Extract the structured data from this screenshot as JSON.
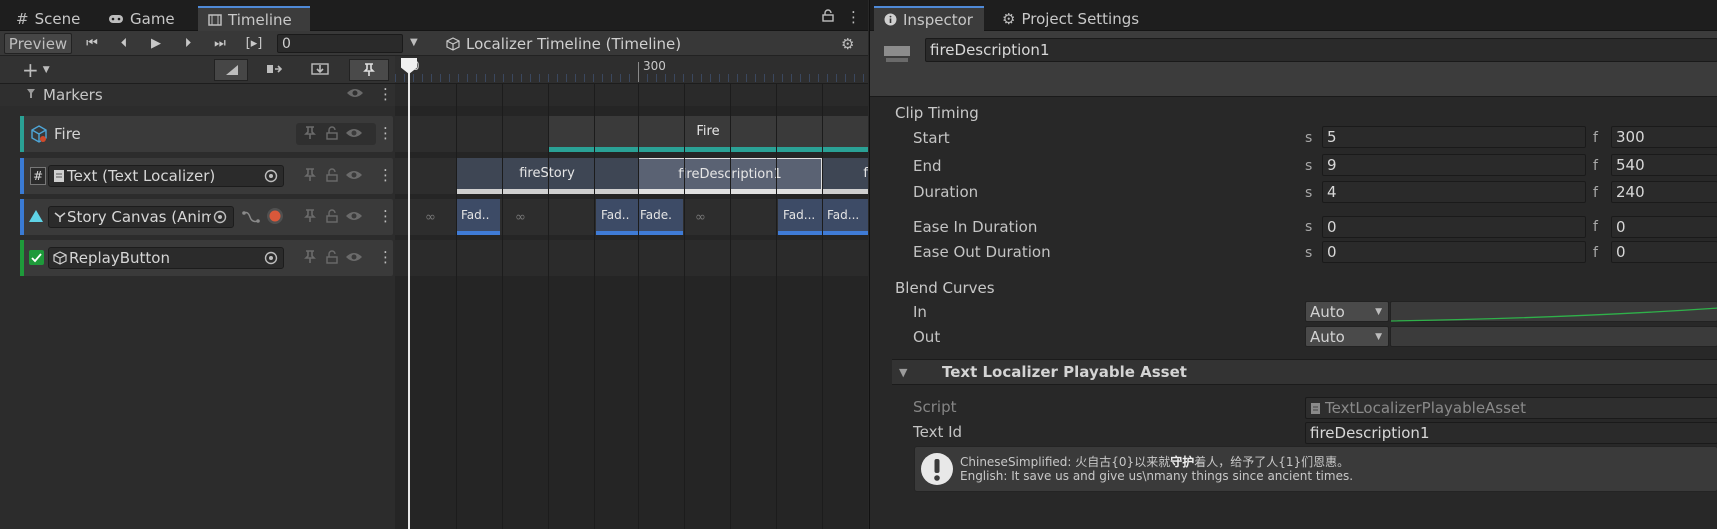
{
  "left_tabs": [
    {
      "label": "Scene",
      "icon": "grid-icon"
    },
    {
      "label": "Game",
      "icon": "gamepad-icon"
    },
    {
      "label": "Timeline",
      "icon": "film-icon"
    }
  ],
  "toolbar": {
    "preview_label": "Preview",
    "frame_value": "0",
    "asset_name": "Localizer Timeline (Timeline)"
  },
  "ruler": {
    "labels": [
      "0",
      "300"
    ]
  },
  "markers_label": "Markers",
  "tracks": [
    {
      "name": "Fire",
      "color": "#2aa195"
    },
    {
      "name": "Text (Text Localizer)",
      "color": "#3a7bd5"
    },
    {
      "name": "Story Canvas (Anim",
      "color": "#3a7bd5"
    },
    {
      "name": "ReplayButton",
      "color": "#1e9a3a"
    }
  ],
  "clips": {
    "fire": "Fire",
    "fire_story": "fireStory",
    "fire_description": "fireDescription1",
    "partial": "f",
    "fade_short": "Fad..",
    "fade_cut": "Fade.",
    "fade_long": "Fad..."
  },
  "inspector": {
    "tabs": [
      {
        "label": "Inspector",
        "icon": "info-icon"
      },
      {
        "label": "Project Settings",
        "icon": "gear-icon"
      }
    ],
    "name_value": "fireDescription1",
    "clip_timing_title": "Clip Timing",
    "unit_s": "s",
    "unit_f": "f",
    "rows": [
      {
        "label": "Start",
        "s": "5",
        "f": "300"
      },
      {
        "label": "End",
        "s": "9",
        "f": "540"
      },
      {
        "label": "Duration",
        "s": "4",
        "f": "240"
      },
      {
        "label": "Ease In Duration",
        "s": "0",
        "f": "0"
      },
      {
        "label": "Ease Out Duration",
        "s": "0",
        "f": "0"
      }
    ],
    "blend_curves_title": "Blend Curves",
    "blend_in_label": "In",
    "blend_out_label": "Out",
    "blend_in_value": "Auto",
    "blend_out_value": "Auto",
    "asset_section_title": "Text Localizer Playable Asset",
    "script_label": "Script",
    "script_value": "TextLocalizerPlayableAsset",
    "text_id_label": "Text Id",
    "text_id_value": "fireDescription1",
    "help_line1_prefix": "ChineseSimplified: 火自古{0}以来就",
    "help_line1_bold": "守护",
    "help_line1_suffix": "着人，给予了人{1}们恩惠。",
    "help_line2": "English: It save us and give us\\nmany things since ancient times."
  }
}
